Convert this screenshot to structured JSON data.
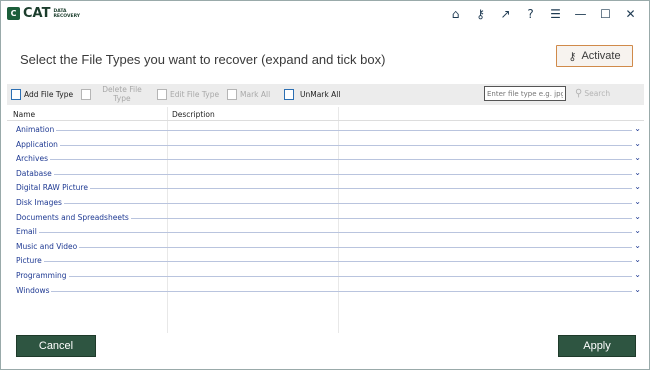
{
  "app": {
    "logo_mark": "C",
    "logo_text": "CAT",
    "logo_sub": "DATA RECOVERY"
  },
  "titlebar_buttons": [
    {
      "icon": "home-icon",
      "glyph": "⌂"
    },
    {
      "icon": "key-icon",
      "glyph": "⚷"
    },
    {
      "icon": "arrow-up-right-icon",
      "glyph": "↗"
    },
    {
      "icon": "help-icon",
      "glyph": "?"
    },
    {
      "icon": "menu-icon",
      "glyph": "☰"
    },
    {
      "icon": "minimize-icon",
      "glyph": "—"
    },
    {
      "icon": "maximize-icon",
      "glyph": "☐"
    },
    {
      "icon": "close-icon",
      "glyph": "✕"
    }
  ],
  "header": {
    "title": "Select the File Types you want to recover (expand and tick box)",
    "activate_label": "Activate"
  },
  "toolbar": {
    "add_file_type": "Add File Type",
    "delete_file_type": "Delete File Type",
    "edit_file_type": "Edit File Type",
    "mark_all": "Mark All",
    "unmark_all": "UnMark All",
    "search_placeholder": "Enter file type e.g. jpg",
    "search_label": "Search"
  },
  "table": {
    "columns": [
      "Name",
      "Description"
    ],
    "rows": [
      "Animation",
      "Application",
      "Archives",
      "Database",
      "Digital RAW Picture",
      "Disk Images",
      "Documents and Spreadsheets",
      "Email",
      "Music and Video",
      "Picture",
      "Programming",
      "Windows"
    ]
  },
  "footer": {
    "cancel_label": "Cancel",
    "apply_label": "Apply"
  },
  "colors": {
    "brand": "#2e5541",
    "link": "#1f3a93",
    "activate_border": "#d08a4a"
  }
}
